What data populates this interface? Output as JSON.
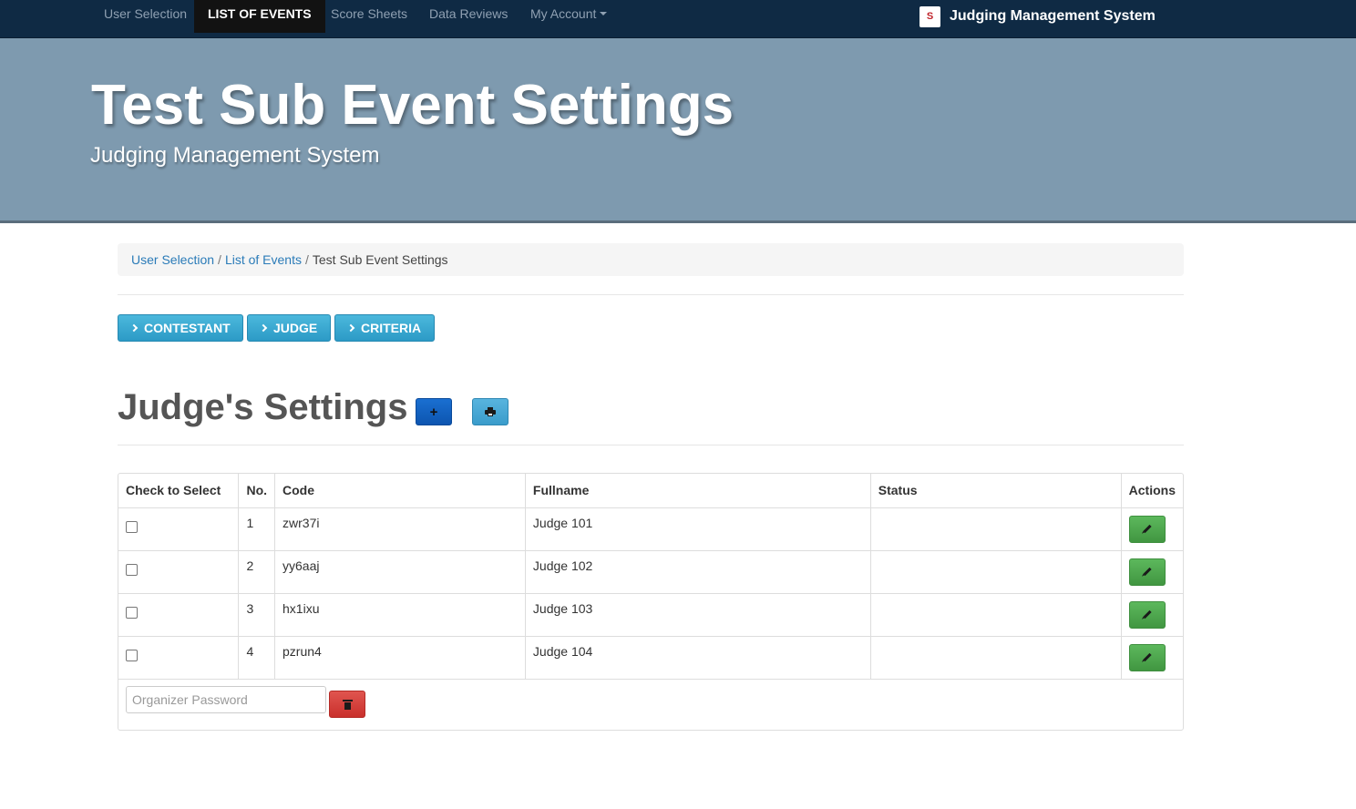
{
  "nav": {
    "items": [
      {
        "label": "User Selection"
      },
      {
        "label": "LIST OF EVENTS"
      },
      {
        "label": "Score Sheets"
      },
      {
        "label": "Data Reviews"
      },
      {
        "label": "My Account"
      }
    ],
    "brand": "Judging Management System"
  },
  "jumbotron": {
    "title": "Test Sub Event Settings",
    "subtitle": "Judging Management System"
  },
  "breadcrumb": {
    "items": [
      "User Selection",
      "List of Events"
    ],
    "current": "Test Sub Event Settings"
  },
  "sections": [
    "CONTESTANT",
    "JUDGE",
    "CRITERIA"
  ],
  "heading": "Judge's Settings",
  "table": {
    "headers": [
      "Check to Select",
      "No.",
      "Code",
      "Fullname",
      "Status",
      "Actions"
    ],
    "rows": [
      {
        "no": "1",
        "code": "zwr37i",
        "fullname": "Judge 101",
        "status": ""
      },
      {
        "no": "2",
        "code": "yy6aaj",
        "fullname": "Judge 102",
        "status": ""
      },
      {
        "no": "3",
        "code": "hx1ixu",
        "fullname": "Judge 103",
        "status": ""
      },
      {
        "no": "4",
        "code": "pzrun4",
        "fullname": "Judge 104",
        "status": ""
      }
    ]
  },
  "password": {
    "placeholder": "Organizer Password"
  },
  "colors": {
    "navbar": "#0f2a44",
    "jumbotron": "#7e9aaf",
    "link": "#2a7bb8",
    "edit": "#5cb85c",
    "delete": "#d9534f"
  }
}
